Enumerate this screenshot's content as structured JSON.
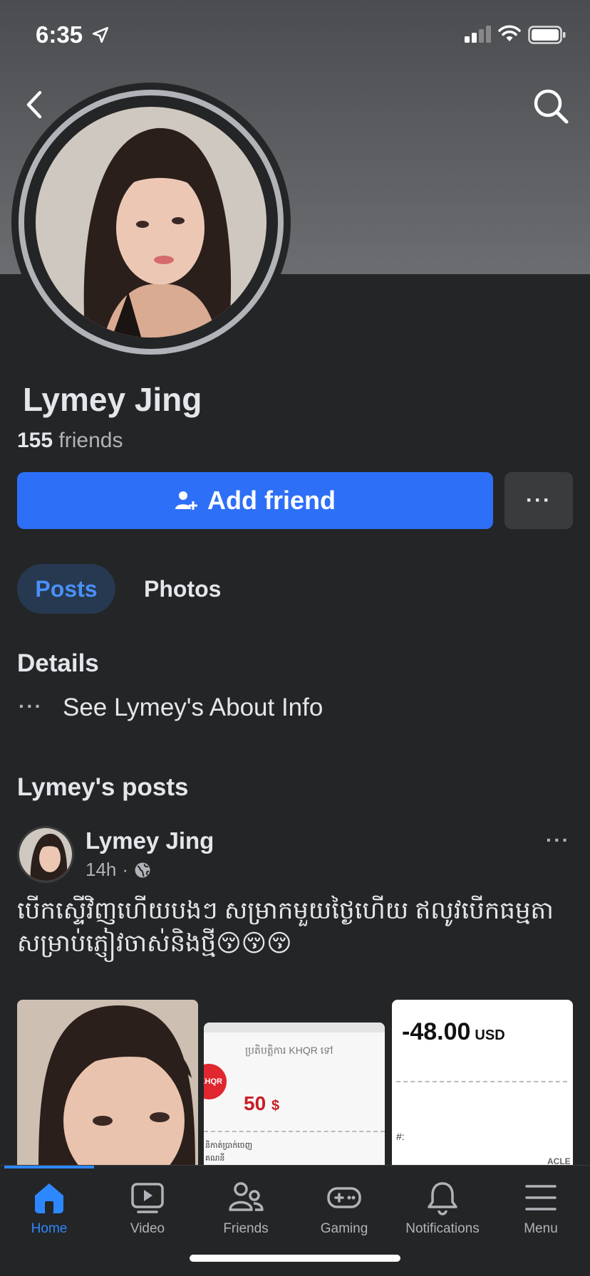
{
  "status_bar": {
    "time": "6:35"
  },
  "profile": {
    "name": "Lymey Jing",
    "friends_count": "155",
    "friends_suffix": " friends",
    "add_friend_label": "Add friend",
    "more_label": "···"
  },
  "tabs": [
    {
      "label": "Posts",
      "active": true
    },
    {
      "label": "Photos",
      "active": false
    }
  ],
  "details": {
    "title": "Details",
    "dots": "···",
    "about_link": "See Lymey's About Info"
  },
  "posts_section": {
    "title": "Lymey's posts",
    "post": {
      "author": "Lymey Jing",
      "time": "14h",
      "separator": "·",
      "more": "···",
      "text": "បើកស្ទើវិញហើយបងៗ សម្រាកមួយថ្ងៃហើយ ឥលូវបើកធម្មតា សម្រាប់ភ្ញៀវចាស់និងថ្មី😚😚😚",
      "image2": {
        "title": "ប្រតិបត្តិការ KHQR ទៅ",
        "badge": "KHQR",
        "amount": "50",
        "currency": "$",
        "line1": "និកាត់ប្រាក់ចេញ",
        "line2": "គណនី"
      },
      "image3": {
        "amount": "-48.00",
        "currency": "USD",
        "hash": "#:",
        "footer": "ACLE"
      }
    }
  },
  "nav": {
    "items": [
      {
        "label": "Home",
        "icon": "home-icon",
        "active": true
      },
      {
        "label": "Video",
        "icon": "video-icon",
        "active": false
      },
      {
        "label": "Friends",
        "icon": "friends-icon",
        "active": false
      },
      {
        "label": "Gaming",
        "icon": "gaming-icon",
        "active": false
      },
      {
        "label": "Notifications",
        "icon": "bell-icon",
        "active": false
      },
      {
        "label": "Menu",
        "icon": "menu-icon",
        "active": false
      }
    ]
  },
  "colors": {
    "accent": "#2d6ff7",
    "background": "#242526",
    "active_tab_bg": "#263951",
    "active_text": "#4a8ff7"
  }
}
